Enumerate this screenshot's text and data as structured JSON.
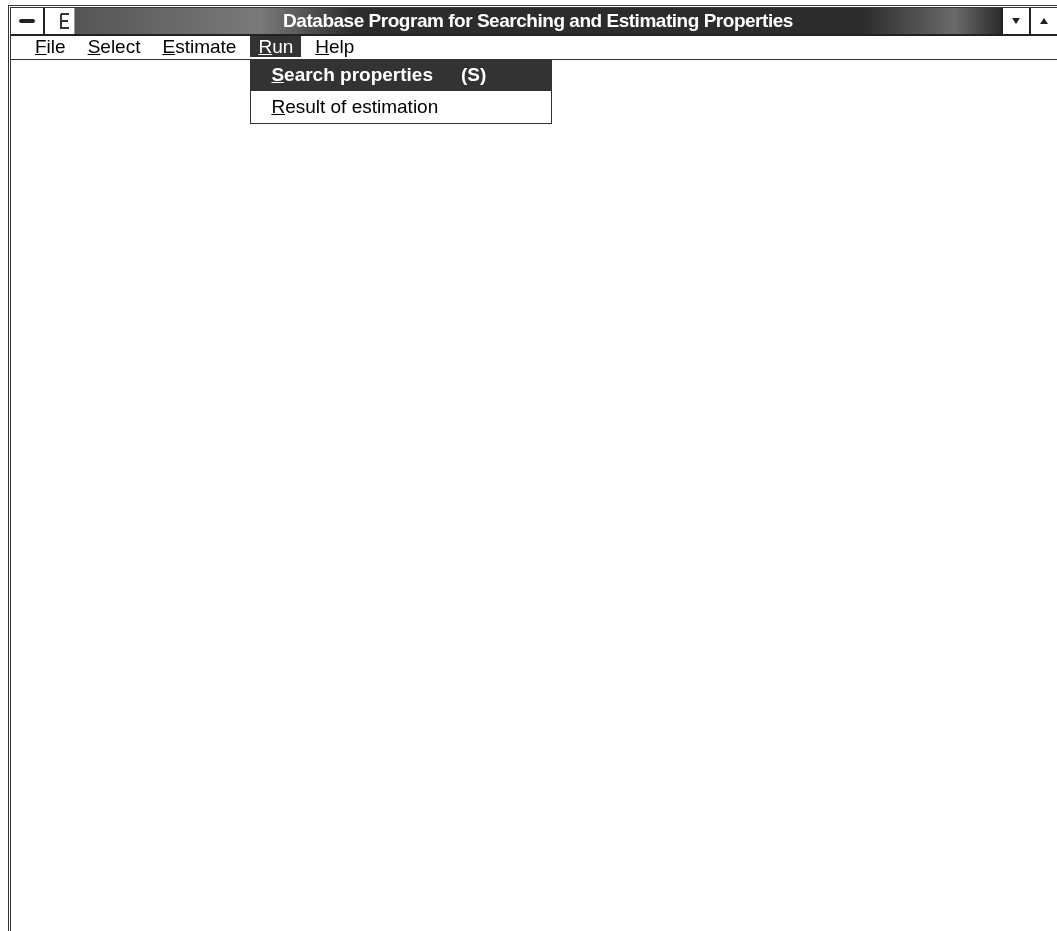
{
  "window": {
    "title": "Database Program for Searching and Estimating Properties"
  },
  "menu_bar": [
    {
      "label": "File",
      "selected": false
    },
    {
      "label": "Select",
      "selected": false
    },
    {
      "label": "Estimate",
      "selected": false
    },
    {
      "label": "Run",
      "selected": true
    },
    {
      "label": "Help",
      "selected": false
    }
  ],
  "dropdown": {
    "items": [
      {
        "label": "Search properties",
        "shortcut": "(S)",
        "selected": true
      },
      {
        "label": "Result of estimation",
        "selected": false
      }
    ]
  }
}
